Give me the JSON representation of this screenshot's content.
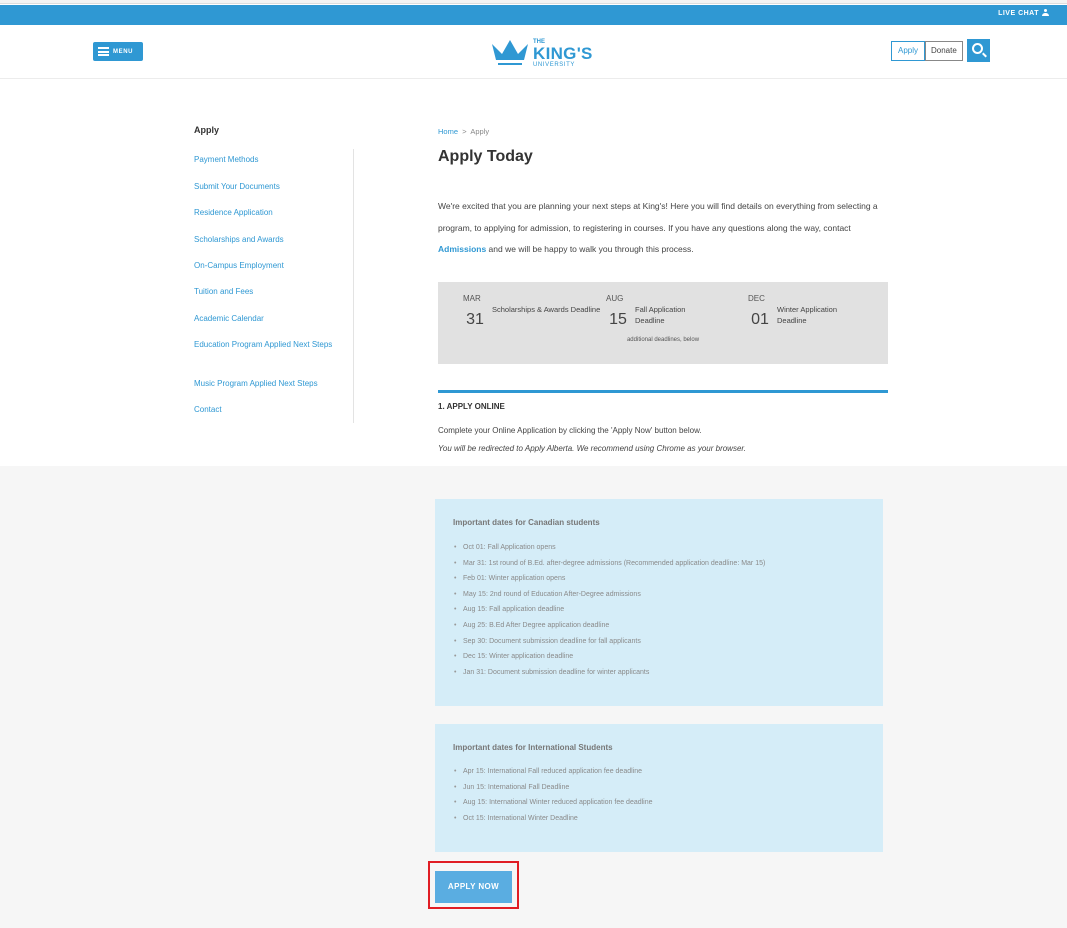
{
  "topbar": {
    "live_chat": "LIVE CHAT"
  },
  "header": {
    "menu_label": "MENU",
    "logo": {
      "the": "THE",
      "kings": "KING'S",
      "university": "UNIVERSITY"
    },
    "apply_label": "Apply",
    "donate_label": "Donate"
  },
  "sidebar": {
    "title": "Apply",
    "items": [
      "Payment Methods",
      "Submit Your Documents",
      "Residence Application",
      "Scholarships and Awards",
      "On-Campus Employment",
      "Tuition and Fees",
      "Academic Calendar",
      "Education Program Applied Next Steps",
      "Music Program Applied Next Steps",
      "Contact"
    ]
  },
  "breadcrumb": {
    "home": "Home",
    "separator": ">",
    "current": "Apply"
  },
  "page_title": "Apply Today",
  "intro": {
    "before": "We're excited that you are planning your next steps at King's! Here you will find details on everything from selecting a program, to applying for admission, to registering in courses. If you have any questions along the way, contact ",
    "link": "Admissions",
    "after": " and we will be happy to walk you through this process."
  },
  "deadlines": {
    "items": [
      {
        "month": "MAR",
        "day": "31",
        "label": "Scholarships & Awards Deadline"
      },
      {
        "month": "AUG",
        "day": "15",
        "label": "Fall Application Deadline"
      },
      {
        "month": "DEC",
        "day": "01",
        "label": "Winter Application Deadline"
      }
    ],
    "note": "additional deadlines, below"
  },
  "step1": {
    "title": "1. APPLY ONLINE",
    "text": "Complete your Online Application by clicking the 'Apply Now' button below.",
    "note": "You will be redirected to Apply Alberta. We recommend using Chrome as your browser."
  },
  "canadian": {
    "title": "Important dates for Canadian students",
    "items": [
      "Oct 01: Fall Application opens",
      "Mar 31: 1st round of B.Ed. after-degree admissions (Recommended application deadline: Mar 15)",
      "Feb 01: Winter application opens",
      "May 15: 2nd round of Education After-Degree admissions",
      "Aug 15: Fall application deadline",
      "Aug 25: B.Ed After Degree application deadline",
      "Sep 30: Document submission deadline for fall applicants",
      "Dec 15: Winter application deadline",
      "Jan 31: Document submission deadline for winter applicants"
    ]
  },
  "international": {
    "title": "Important dates for International Students",
    "items": [
      "Apr 15: International Fall reduced application fee deadline",
      "Jun 15: International Fall Deadline",
      "Aug 15: International Winter reduced application fee deadline",
      "Oct 15: International Winter Deadline"
    ]
  },
  "apply_now": "APPLY NOW",
  "colors": {
    "brand_blue": "#2f98d3",
    "highlight_red": "#e01d24",
    "date_box_bg": "#d5edf8"
  },
  "icons": [
    "person-icon",
    "hamburger-icon",
    "crown-logo-icon",
    "search-icon"
  ]
}
